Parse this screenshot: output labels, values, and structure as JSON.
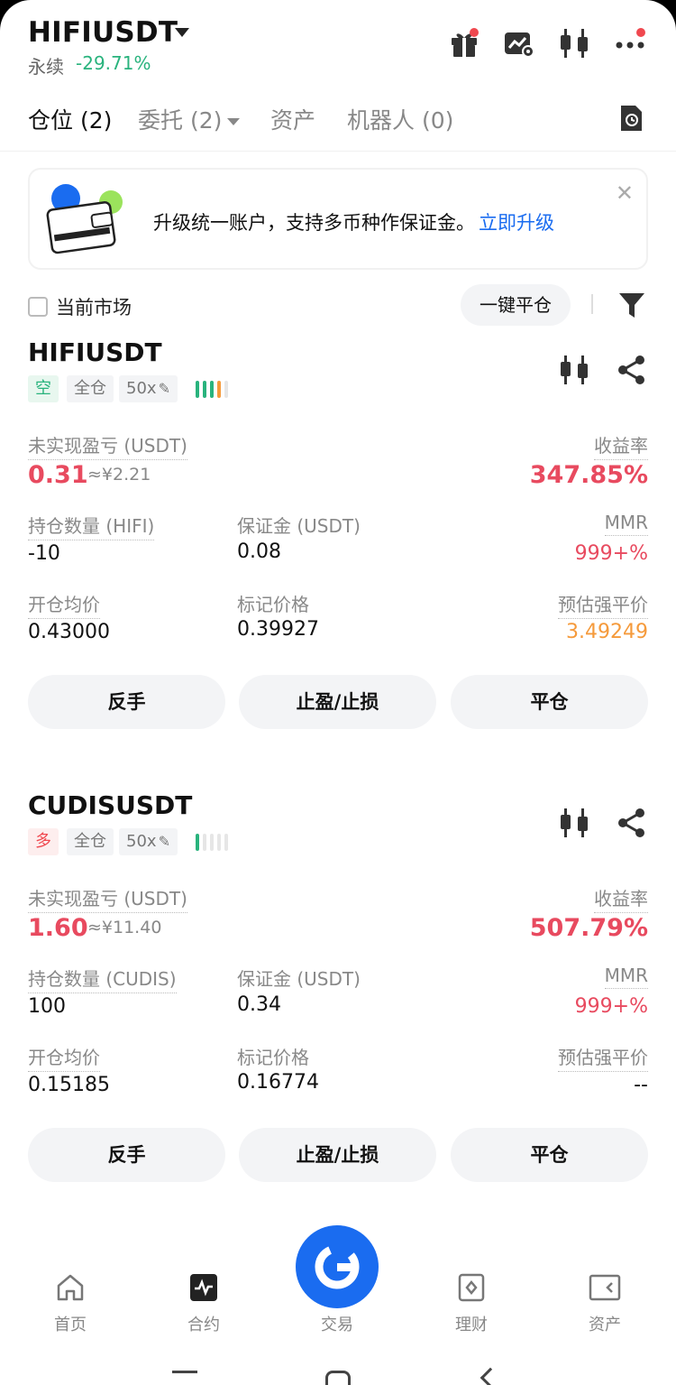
{
  "header": {
    "symbol": "HIFIUSDT",
    "contract_type": "永续",
    "change": "-29.71%",
    "change_color": "#29b37d"
  },
  "tabs": [
    {
      "label": "仓位 (2)",
      "active": true
    },
    {
      "label": "委托 (2)",
      "active": false
    },
    {
      "label": "资产",
      "active": false
    },
    {
      "label": "机器人 (0)",
      "active": false
    }
  ],
  "banner": {
    "text": "升级统一账户，支持多币种作保证金。",
    "link": "立即升级"
  },
  "filter": {
    "current_market_label": "当前市场",
    "close_all_label": "一键平仓"
  },
  "positions": [
    {
      "symbol": "HIFIUSDT",
      "side": "空",
      "margin_mode": "全仓",
      "leverage": "50x",
      "risk_level": "4 of 5",
      "pnl_label": "未实现盈亏 (USDT)",
      "pnl": "0.31",
      "pnl_cny": "≈¥2.21",
      "roe_label": "收益率",
      "roe": "347.85%",
      "size_label": "持仓数量 (HIFI)",
      "size": "-10",
      "margin_label": "保证金 (USDT)",
      "margin": "0.08",
      "mmr_label": "MMR",
      "mmr": "999+%",
      "entry_label": "开仓均价",
      "entry": "0.43000",
      "mark_label": "标记价格",
      "mark": "0.39927",
      "liq_label": "预估强平价",
      "liq": "3.49249",
      "buttons": {
        "reverse": "反手",
        "tpsl": "止盈/止损",
        "close": "平仓"
      }
    },
    {
      "symbol": "CUDISUSDT",
      "side": "多",
      "margin_mode": "全仓",
      "leverage": "50x",
      "risk_level": "1 of 5",
      "pnl_label": "未实现盈亏 (USDT)",
      "pnl": "1.60",
      "pnl_cny": "≈¥11.40",
      "roe_label": "收益率",
      "roe": "507.79%",
      "size_label": "持仓数量 (CUDIS)",
      "size": "100",
      "margin_label": "保证金 (USDT)",
      "margin": "0.34",
      "mmr_label": "MMR",
      "mmr": "999+%",
      "entry_label": "开仓均价",
      "entry": "0.15185",
      "mark_label": "标记价格",
      "mark": "0.16774",
      "liq_label": "预估强平价",
      "liq": "--",
      "buttons": {
        "reverse": "反手",
        "tpsl": "止盈/止损",
        "close": "平仓"
      }
    }
  ],
  "nav": [
    {
      "label": "首页",
      "icon": "home-icon"
    },
    {
      "label": "合约",
      "icon": "futures-icon"
    },
    {
      "label": "交易",
      "icon": "trade-icon"
    },
    {
      "label": "理财",
      "icon": "earn-icon"
    },
    {
      "label": "资产",
      "icon": "wallet-icon"
    }
  ],
  "colors": {
    "accent": "#1a6cf0",
    "red": "#e84a5f",
    "green": "#29b37d",
    "orange": "#f59a3b"
  }
}
